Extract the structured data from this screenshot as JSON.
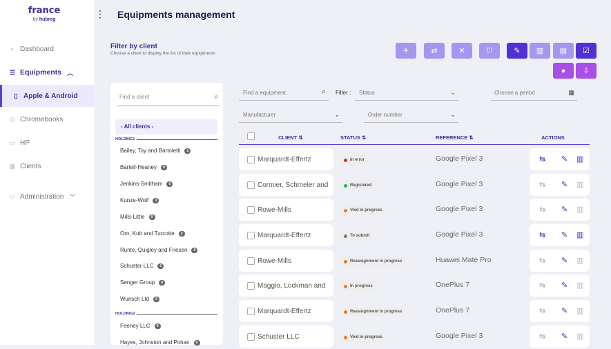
{
  "brand": {
    "name": "france",
    "by": "by",
    "product": "hubreg"
  },
  "sidebar": {
    "items": [
      {
        "label": "Dashboard",
        "icon": "dashboard-icon"
      },
      {
        "label": "Equipments",
        "icon": "database-icon"
      },
      {
        "label": "Apple & Android",
        "icon": "phone-icon"
      },
      {
        "label": "Chromebooks",
        "icon": "chrome-icon"
      },
      {
        "label": "HP",
        "icon": "laptop-icon"
      },
      {
        "label": "Clients",
        "icon": "building-icon"
      },
      {
        "label": "Administration",
        "icon": "users-icon"
      }
    ]
  },
  "page": {
    "title": "Equipments management",
    "filter_title": "Filter by client",
    "filter_subtitle": "Choose a client to display the list of their equipments"
  },
  "clients": {
    "search_placeholder": "Find a client",
    "all_label": "- All clients -",
    "holding1": "HOLDING1",
    "holding2": "HOLDING2",
    "items": [
      {
        "name": "Bailey, Toy and Bartoletti",
        "count": "1"
      },
      {
        "name": "Bartell-Heaney",
        "count": "0"
      },
      {
        "name": "Jenkins-Smitham",
        "count": "0"
      },
      {
        "name": "Kunze-Wolf",
        "count": "3"
      },
      {
        "name": "Mills-Little",
        "count": "0"
      },
      {
        "name": "Orn, Kub and Turcotte",
        "count": "2"
      },
      {
        "name": "Runte, Quigley and Friesen",
        "count": "0"
      },
      {
        "name": "Schuster LLC",
        "count": "1"
      },
      {
        "name": "Senger Group",
        "count": "0"
      },
      {
        "name": "Wunsch Ltd",
        "count": "0"
      },
      {
        "name": "Feeney LLC",
        "count": "0"
      },
      {
        "name": "Hayes, Johnston and Pohan",
        "count": "0"
      }
    ]
  },
  "filters": {
    "equipment_placeholder": "Find a equipment",
    "filter_label": "Filter :",
    "status": "Status",
    "period": "Choose a period",
    "manufacturer": "Manufacturer",
    "order_number": "Order number"
  },
  "table": {
    "headers": {
      "client": "CLIENT",
      "status": "STATUS",
      "reference": "REFERENCE",
      "actions": "ACTIONS"
    },
    "rows": [
      {
        "client": "Marquardt-Effertz",
        "status": "In error",
        "status_color": "#c0392b",
        "reference": "Google Pixel 3",
        "active": true
      },
      {
        "client": "Cormier, Schmeler and",
        "status": "Registered",
        "status_color": "#27ae60",
        "reference": "Google Pixel 3",
        "active": false
      },
      {
        "client": "Rowe-Mills",
        "status": "Void in progress",
        "status_color": "#e67e22",
        "reference": "Google Pixel 3",
        "active": false
      },
      {
        "client": "Marquardt-Effertz",
        "status": "To submit",
        "status_color": "#777777",
        "reference": "Google Pixel 3",
        "active": true
      },
      {
        "client": "Rowe-Mills",
        "status": "Reassignment in progress",
        "status_color": "#e67e22",
        "reference": "Huawei Mate Pro",
        "active": false
      },
      {
        "client": "Maggio, Lockman and",
        "status": "In progress",
        "status_color": "#e67e22",
        "reference": "OnePlus 7",
        "active": false
      },
      {
        "client": "Marquardt-Effertz",
        "status": "Reassignment in progress",
        "status_color": "#e67e22",
        "reference": "OnePlus 7",
        "active": false
      },
      {
        "client": "Schuster LLC",
        "status": "Void in progress",
        "status_color": "#e67e22",
        "reference": "Google Pixel 3",
        "active": false
      }
    ]
  },
  "colors": {
    "accent": "#5131d2",
    "accent_light": "#a796ee",
    "magenta": "#a94ee6",
    "brand": "#3d2d9c"
  }
}
